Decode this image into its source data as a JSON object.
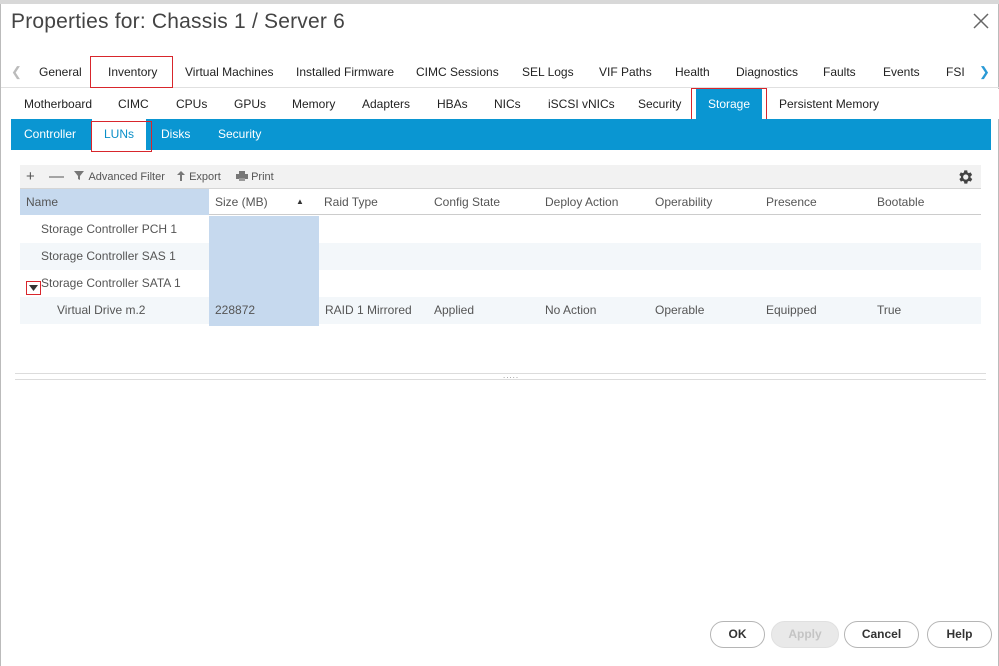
{
  "dialog": {
    "title": "Properties for: Chassis 1 / Server 6"
  },
  "tabs_level1": {
    "items": [
      "General",
      "Inventory",
      "Virtual Machines",
      "Installed Firmware",
      "CIMC Sessions",
      "SEL Logs",
      "VIF Paths",
      "Health",
      "Diagnostics",
      "Faults",
      "Events",
      "FSI"
    ],
    "active": "Inventory"
  },
  "tabs_level2": {
    "items": [
      "Motherboard",
      "CIMC",
      "CPUs",
      "GPUs",
      "Memory",
      "Adapters",
      "HBAs",
      "NICs",
      "iSCSI vNICs",
      "Security",
      "Storage",
      "Persistent Memory"
    ],
    "active": "Storage"
  },
  "tabs_level3": {
    "items": [
      "Controller",
      "LUNs",
      "Disks",
      "Security"
    ],
    "active": "LUNs"
  },
  "toolbar": {
    "add": "+",
    "remove": "—",
    "advanced_filter": "Advanced Filter",
    "export": "Export",
    "print": "Print"
  },
  "table": {
    "columns": [
      "Name",
      "Size (MB)",
      "Raid Type",
      "Config State",
      "Deploy Action",
      "Operability",
      "Presence",
      "Bootable"
    ],
    "sorted_column": "Size (MB)",
    "rows": [
      [
        "Storage Controller PCH 1",
        "",
        "",
        "",
        "",
        "",
        "",
        ""
      ],
      [
        "Storage Controller SAS 1",
        "",
        "",
        "",
        "",
        "",
        "",
        ""
      ],
      [
        "Storage Controller SATA 1",
        "",
        "",
        "",
        "",
        "",
        "",
        ""
      ],
      [
        "Virtual Drive m.2",
        "228872",
        "RAID 1 Mirrored",
        "Applied",
        "No Action",
        "Operable",
        "Equipped",
        "True"
      ]
    ]
  },
  "splitter": {
    "grip": "....."
  },
  "footer": {
    "ok": "OK",
    "apply": "Apply",
    "cancel": "Cancel",
    "help": "Help"
  },
  "colors": {
    "accent": "#0a96d2",
    "highlight_border": "#d8262c",
    "selected_column": "#c6d9ee"
  },
  "icons": [
    "close-icon",
    "chevron-left-icon",
    "chevron-right-icon",
    "filter-icon",
    "export-arrow-icon",
    "printer-icon",
    "gear-icon",
    "expand-triangle-icon"
  ]
}
